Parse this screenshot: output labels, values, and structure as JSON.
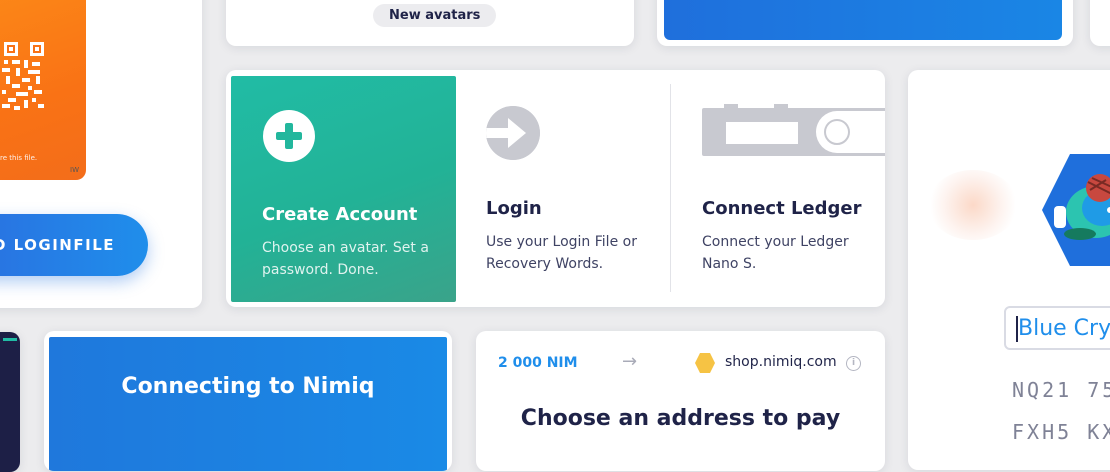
{
  "loginfile": {
    "caption": "re this file.",
    "badge": "IW",
    "download_label": "AD LOGINFILE"
  },
  "avatars": {
    "badge": "New avatars"
  },
  "onboarding": {
    "create": {
      "title": "Create Account",
      "description": "Choose an avatar. Set a password. Done."
    },
    "login": {
      "title": "Login",
      "description": "Use your Login File or Recovery Words."
    },
    "ledger": {
      "title": "Connect Ledger",
      "description": "Connect your Ledger Nano S."
    }
  },
  "identicon_card": {
    "label_value": "Blue Cry",
    "address_line_1": "NQ21 75",
    "address_line_2": "FXH5 KX"
  },
  "network": {
    "status": "Connecting to Nimiq"
  },
  "payment": {
    "amount": "2 000 NIM",
    "arrow": "→",
    "shop": "shop.nimiq.com",
    "info": "i",
    "title": "Choose an address to pay"
  },
  "colors": {
    "green": "#21bca5",
    "blue": "#1f8eeb",
    "orange": "#f97215",
    "navy": "#1f2348",
    "gold": "#f6c344"
  }
}
